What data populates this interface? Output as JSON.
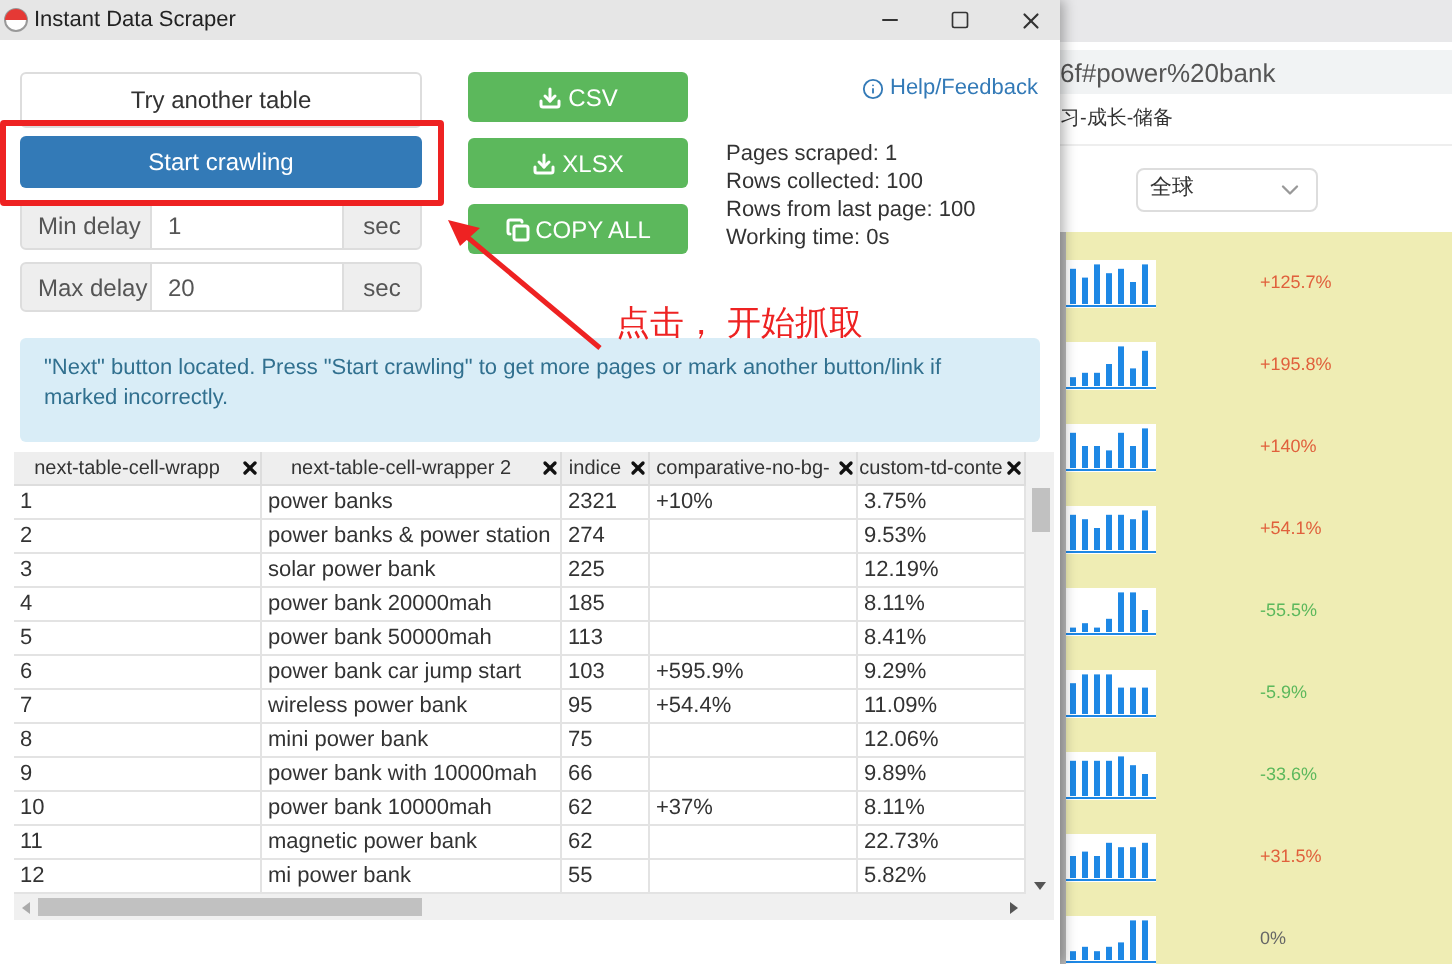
{
  "window": {
    "title": "Instant Data Scraper"
  },
  "buttons": {
    "try_another": "Try another table",
    "start": "Start crawling",
    "csv": "CSV",
    "xlsx": "XLSX",
    "copy_all": "COPY ALL"
  },
  "delays": [
    {
      "label": "Min delay",
      "value": "1",
      "unit": "sec"
    },
    {
      "label": "Max delay",
      "value": "20",
      "unit": "sec"
    }
  ],
  "help_link": "Help/Feedback",
  "stats": [
    "Pages scraped: 1",
    "Rows collected: 100",
    "Rows from last page: 100",
    "Working time: 0s"
  ],
  "annotation": "点击， 开始抓取",
  "info": "\"Next\" button located. Press \"Start crawling\" to get more pages or mark another button/link if marked incorrectly.",
  "table": {
    "columns": [
      "next-table-cell-wrapp",
      "next-table-cell-wrapper 2",
      "indice",
      "comparative-no-bg-",
      "custom-td-conte"
    ],
    "rows": [
      [
        "1",
        "power banks",
        "2321",
        "+10%",
        "3.75%"
      ],
      [
        "2",
        "power banks & power station",
        "274",
        "",
        "9.53%"
      ],
      [
        "3",
        "solar power bank",
        "225",
        "",
        "12.19%"
      ],
      [
        "4",
        "power bank 20000mah",
        "185",
        "",
        "8.11%"
      ],
      [
        "5",
        "power bank 50000mah",
        "113",
        "",
        "8.41%"
      ],
      [
        "6",
        "power bank car jump start",
        "103",
        "+595.9%",
        "9.29%"
      ],
      [
        "7",
        "wireless power bank",
        "95",
        "+54.4%",
        "11.09%"
      ],
      [
        "8",
        "mini power bank",
        "75",
        "",
        "12.06%"
      ],
      [
        "9",
        "power bank with 10000mah",
        "66",
        "",
        "9.89%"
      ],
      [
        "10",
        "power bank 10000mah",
        "62",
        "+37%",
        "8.11%"
      ],
      [
        "11",
        "magnetic power bank",
        "62",
        "",
        "22.73%"
      ],
      [
        "12",
        "mi power bank",
        "55",
        "",
        "5.82%"
      ]
    ]
  },
  "background_page": {
    "url": "6f#power%20bank",
    "breadcrumb": "习-成长-储备",
    "region_select": "全球",
    "trends": [
      {
        "change": "+125.7%",
        "color": "#e0603c"
      },
      {
        "change": "+195.8%",
        "color": "#e0603c"
      },
      {
        "change": "+140%",
        "color": "#e0603c"
      },
      {
        "change": "+54.1%",
        "color": "#e0603c"
      },
      {
        "change": "-55.5%",
        "color": "#5cb85c"
      },
      {
        "change": "-5.9%",
        "color": "#5cb85c"
      },
      {
        "change": "-33.6%",
        "color": "#5cb85c"
      },
      {
        "change": "+31.5%",
        "color": "#e0603c"
      },
      {
        "change": "0%",
        "color": "#666666"
      }
    ]
  }
}
